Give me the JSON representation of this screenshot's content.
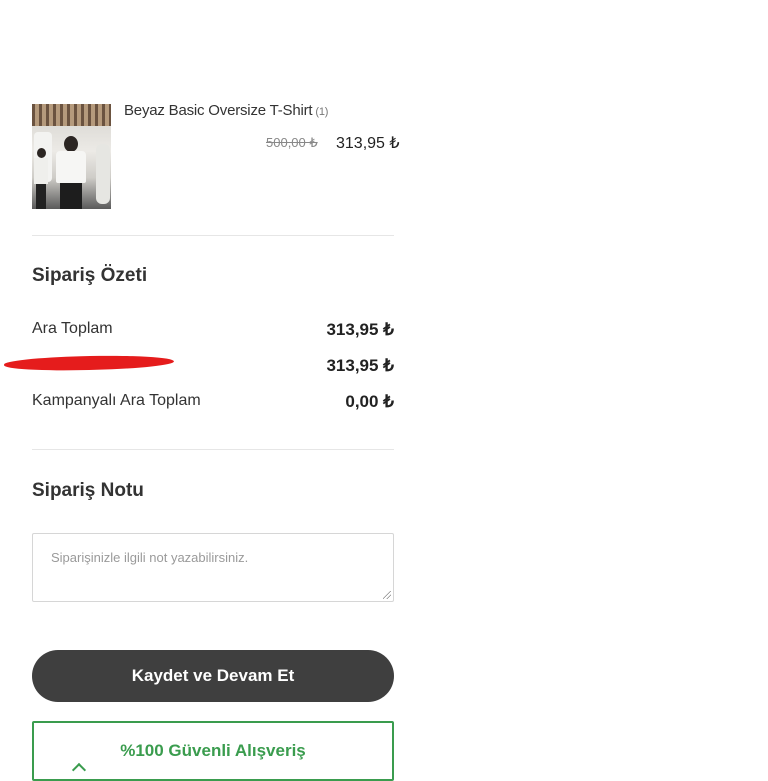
{
  "product": {
    "name": "Beyaz Basic Oversize T-Shirt",
    "quantity": "(1)",
    "old_price": "500,00 ₺",
    "price": "313,95 ₺"
  },
  "summary": {
    "title": "Sipariş Özeti",
    "rows": [
      {
        "label": "Ara Toplam",
        "value": "313,95 ₺"
      },
      {
        "label": "",
        "value": "313,95 ₺"
      },
      {
        "label": "Kampanyalı Ara Toplam",
        "value": "0,00 ₺"
      }
    ]
  },
  "note": {
    "title": "Sipariş Notu",
    "placeholder": "Siparişinizle ilgili not yazabilirsiniz."
  },
  "actions": {
    "save_label": "Kaydet ve Devam Et"
  },
  "security": {
    "label": "%100 Güvenli Alışveriş",
    "icon": "shield-icon"
  },
  "colors": {
    "button_bg": "#3f3f3f",
    "secure_green": "#3a9c4e"
  }
}
